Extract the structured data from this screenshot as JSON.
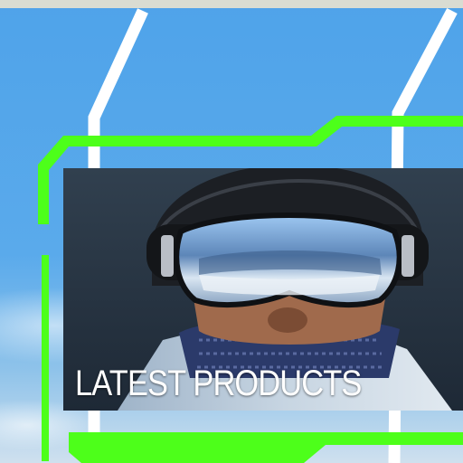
{
  "banner": {
    "title": "LATEST PRODUCTS",
    "image_subject": "skier-with-mirrored-goggles"
  },
  "colors": {
    "accent_green": "#4dff1a",
    "frame_white": "#ffffff",
    "sky_blue": "#5aa6e6"
  }
}
